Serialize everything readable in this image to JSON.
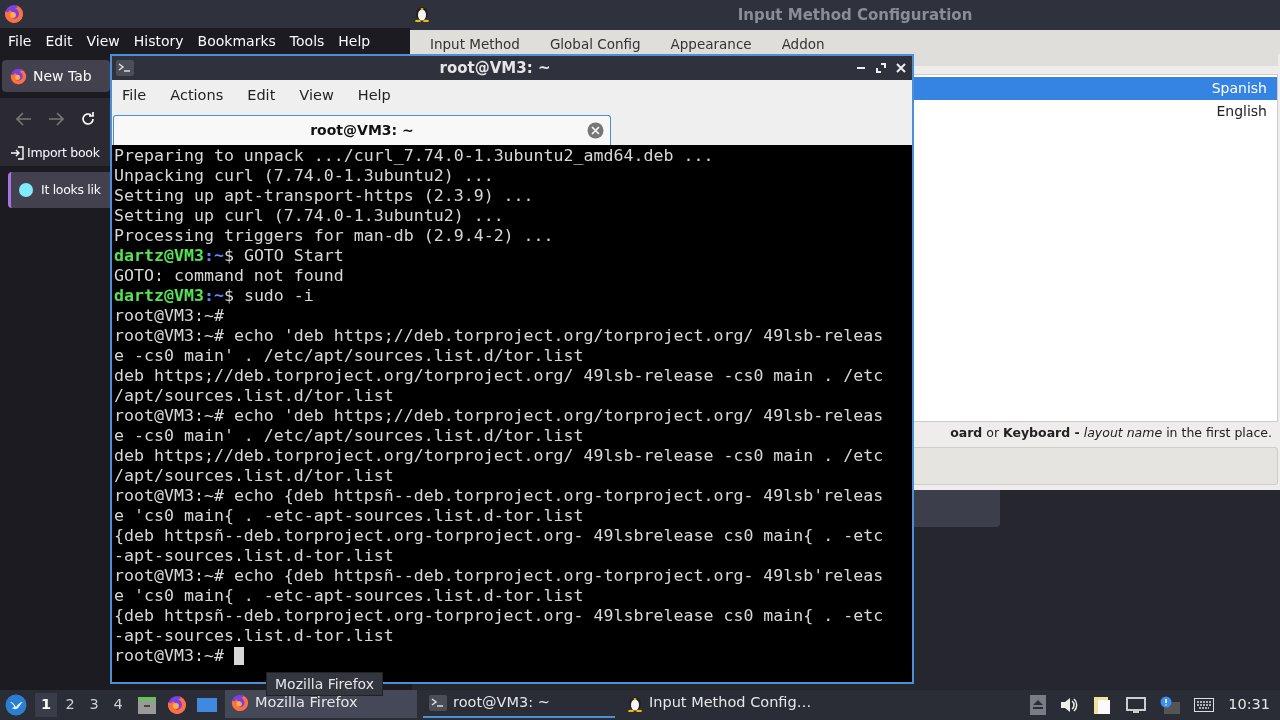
{
  "firefox": {
    "menu": [
      "File",
      "Edit",
      "View",
      "History",
      "Bookmarks",
      "Tools",
      "Help"
    ],
    "tab": "New Tab",
    "bookmark": "Import book",
    "notice": "It looks lik"
  },
  "im_config": {
    "title": "Input Method Configuration",
    "tabs": [
      "Input Method",
      "Global Config",
      "Appearance",
      "Addon"
    ],
    "languages": [
      {
        "label": "Spanish",
        "selected": true
      },
      {
        "label": "English",
        "selected": false
      }
    ],
    "hint": "**oard** or **Keyboard -** *layout name* in the first place."
  },
  "terminal": {
    "title": "root@VM3: ~",
    "menu": [
      "File",
      "Actions",
      "Edit",
      "View",
      "Help"
    ],
    "tab": "root@VM3: ~",
    "lines": [
      {
        "kind": "text",
        "text": "Preparing to unpack .../curl_7.74.0-1.3ubuntu2_amd64.deb ..."
      },
      {
        "kind": "text",
        "text": "Unpacking curl (7.74.0-1.3ubuntu2) ..."
      },
      {
        "kind": "text",
        "text": "Setting up apt-transport-https (2.3.9) ..."
      },
      {
        "kind": "text",
        "text": "Setting up curl (7.74.0-1.3ubuntu2) ..."
      },
      {
        "kind": "text",
        "text": "Processing triggers for man-db (2.9.4-2) ..."
      },
      {
        "kind": "prompt",
        "user": "dartz@VM3",
        "path": ":~",
        "command": "$ GOTO Start"
      },
      {
        "kind": "text",
        "text": "GOTO: command not found"
      },
      {
        "kind": "prompt",
        "user": "dartz@VM3",
        "path": ":~",
        "command": "$ sudo -i"
      },
      {
        "kind": "text",
        "text": "root@VM3:~#"
      },
      {
        "kind": "text",
        "text": "root@VM3:~# echo 'deb https;//deb.torproject.org/torproject.org/ 49lsb-releas"
      },
      {
        "kind": "text",
        "text": "e -cs0 main' . /etc/apt/sources.list.d/tor.list"
      },
      {
        "kind": "text",
        "text": "deb https;//deb.torproject.org/torproject.org/ 49lsb-release -cs0 main . /etc"
      },
      {
        "kind": "text",
        "text": "/apt/sources.list.d/tor.list"
      },
      {
        "kind": "text",
        "text": "root@VM3:~# echo 'deb https;//deb.torproject.org/torproject.org/ 49lsb-releas"
      },
      {
        "kind": "text",
        "text": "e -cs0 main' . /etc/apt/sources.list.d/tor.list"
      },
      {
        "kind": "text",
        "text": "deb https;//deb.torproject.org/torproject.org/ 49lsb-release -cs0 main . /etc"
      },
      {
        "kind": "text",
        "text": "/apt/sources.list.d/tor.list"
      },
      {
        "kind": "text",
        "text": "root@VM3:~# echo {deb httpsñ--deb.torproject.org-torproject.org- 49lsb'releas"
      },
      {
        "kind": "text",
        "text": "e 'cs0 main{ . -etc-apt-sources.list.d-tor.list"
      },
      {
        "kind": "text",
        "text": "{deb httpsñ--deb.torproject.org-torproject.org- 49lsbrelease cs0 main{ . -etc"
      },
      {
        "kind": "text",
        "text": "-apt-sources.list.d-tor.list"
      },
      {
        "kind": "text",
        "text": "root@VM3:~# echo {deb httpsñ--deb.torproject.org-torproject.org- 49lsb'releas"
      },
      {
        "kind": "text",
        "text": "e 'cs0 main{ . -etc-apt-sources.list.d-tor.list"
      },
      {
        "kind": "text",
        "text": "{deb httpsñ--deb.torproject.org-torproject.org- 49lsbrelease cs0 main{ . -etc"
      },
      {
        "kind": "text",
        "text": "-apt-sources.list.d-tor.list"
      },
      {
        "kind": "cursor",
        "text": "root@VM3:~# "
      }
    ]
  },
  "tooltip": "Mozilla Firefox",
  "taskbar": {
    "workspaces": [
      {
        "label": "1",
        "selected": true
      },
      {
        "label": "2",
        "selected": false
      },
      {
        "label": "3",
        "selected": false
      },
      {
        "label": "4",
        "selected": false
      }
    ],
    "tasks": [
      {
        "label": "Mozilla Firefox",
        "hovered": true,
        "selected": false
      },
      {
        "label": "root@VM3: ~",
        "hovered": false,
        "selected": true
      },
      {
        "label": "Input Method Config…",
        "hovered": false,
        "selected": false
      }
    ],
    "clock": "10:31"
  }
}
